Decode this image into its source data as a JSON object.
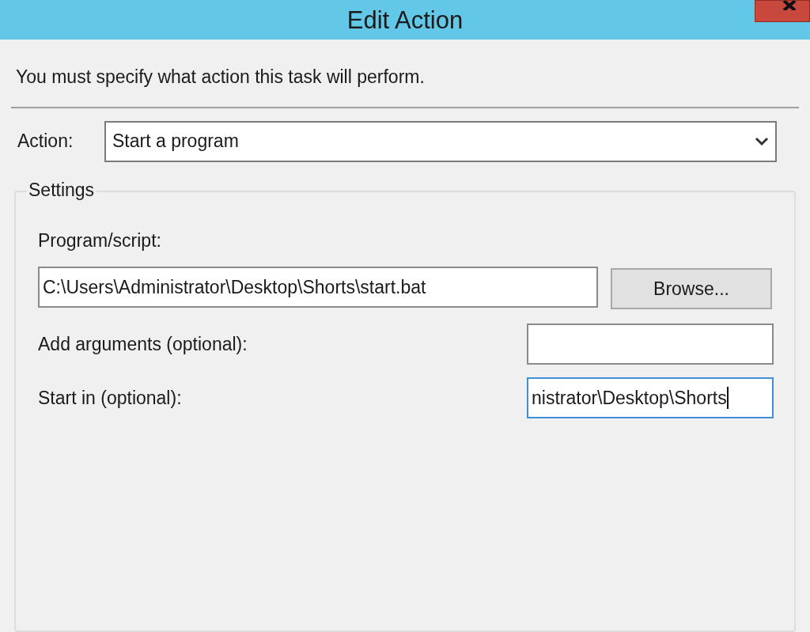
{
  "window": {
    "title": "Edit Action"
  },
  "instruction": "You must specify what action this task will perform.",
  "action": {
    "label": "Action:",
    "value": "Start a program"
  },
  "settings": {
    "title": "Settings",
    "program": {
      "label": "Program/script:",
      "value": "C:\\Users\\Administrator\\Desktop\\Shorts\\start.bat",
      "button": "Browse...",
      "focused": false
    },
    "fields": [
      {
        "label": "Add arguments (optional):",
        "focused": false
      },
      {
        "label": "Start in (optional):",
        "value": "nistrator\\Desktop\\Shorts",
        "focused": true
      }
    ]
  }
}
